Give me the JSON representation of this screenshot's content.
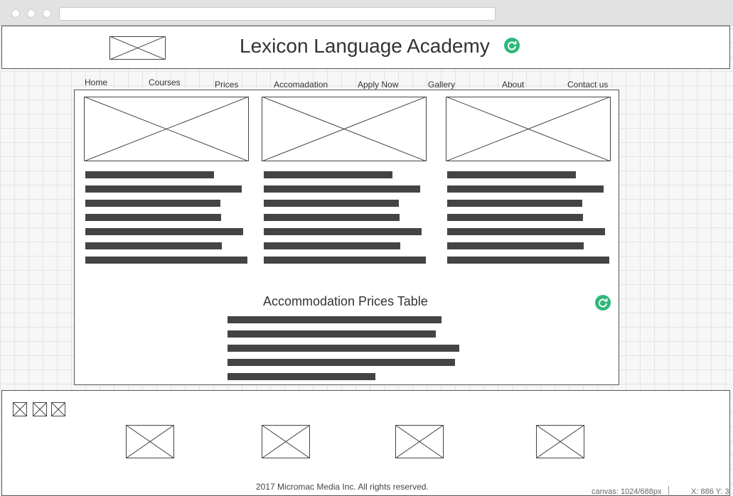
{
  "header": {
    "title": "Lexicon Language Academy"
  },
  "nav": {
    "items": [
      "Home",
      "Courses",
      "Prices",
      "Accomadation",
      "Apply Now",
      "Gallery",
      "About",
      "Contact us"
    ]
  },
  "content": {
    "section_title": "Accommodation Prices Table"
  },
  "footer": {
    "copyright": "2017 Micromac Media Inc. All rights reserved."
  },
  "status_bar": {
    "canvas_label": "canvas",
    "canvas_size": "1024/688px",
    "coords_label": "X",
    "coords_value": "886 Y: 3"
  },
  "colors": {
    "refresh_icon": "#2eb87a",
    "text_bar": "#444444",
    "grid_background": "#f7f7f7"
  }
}
